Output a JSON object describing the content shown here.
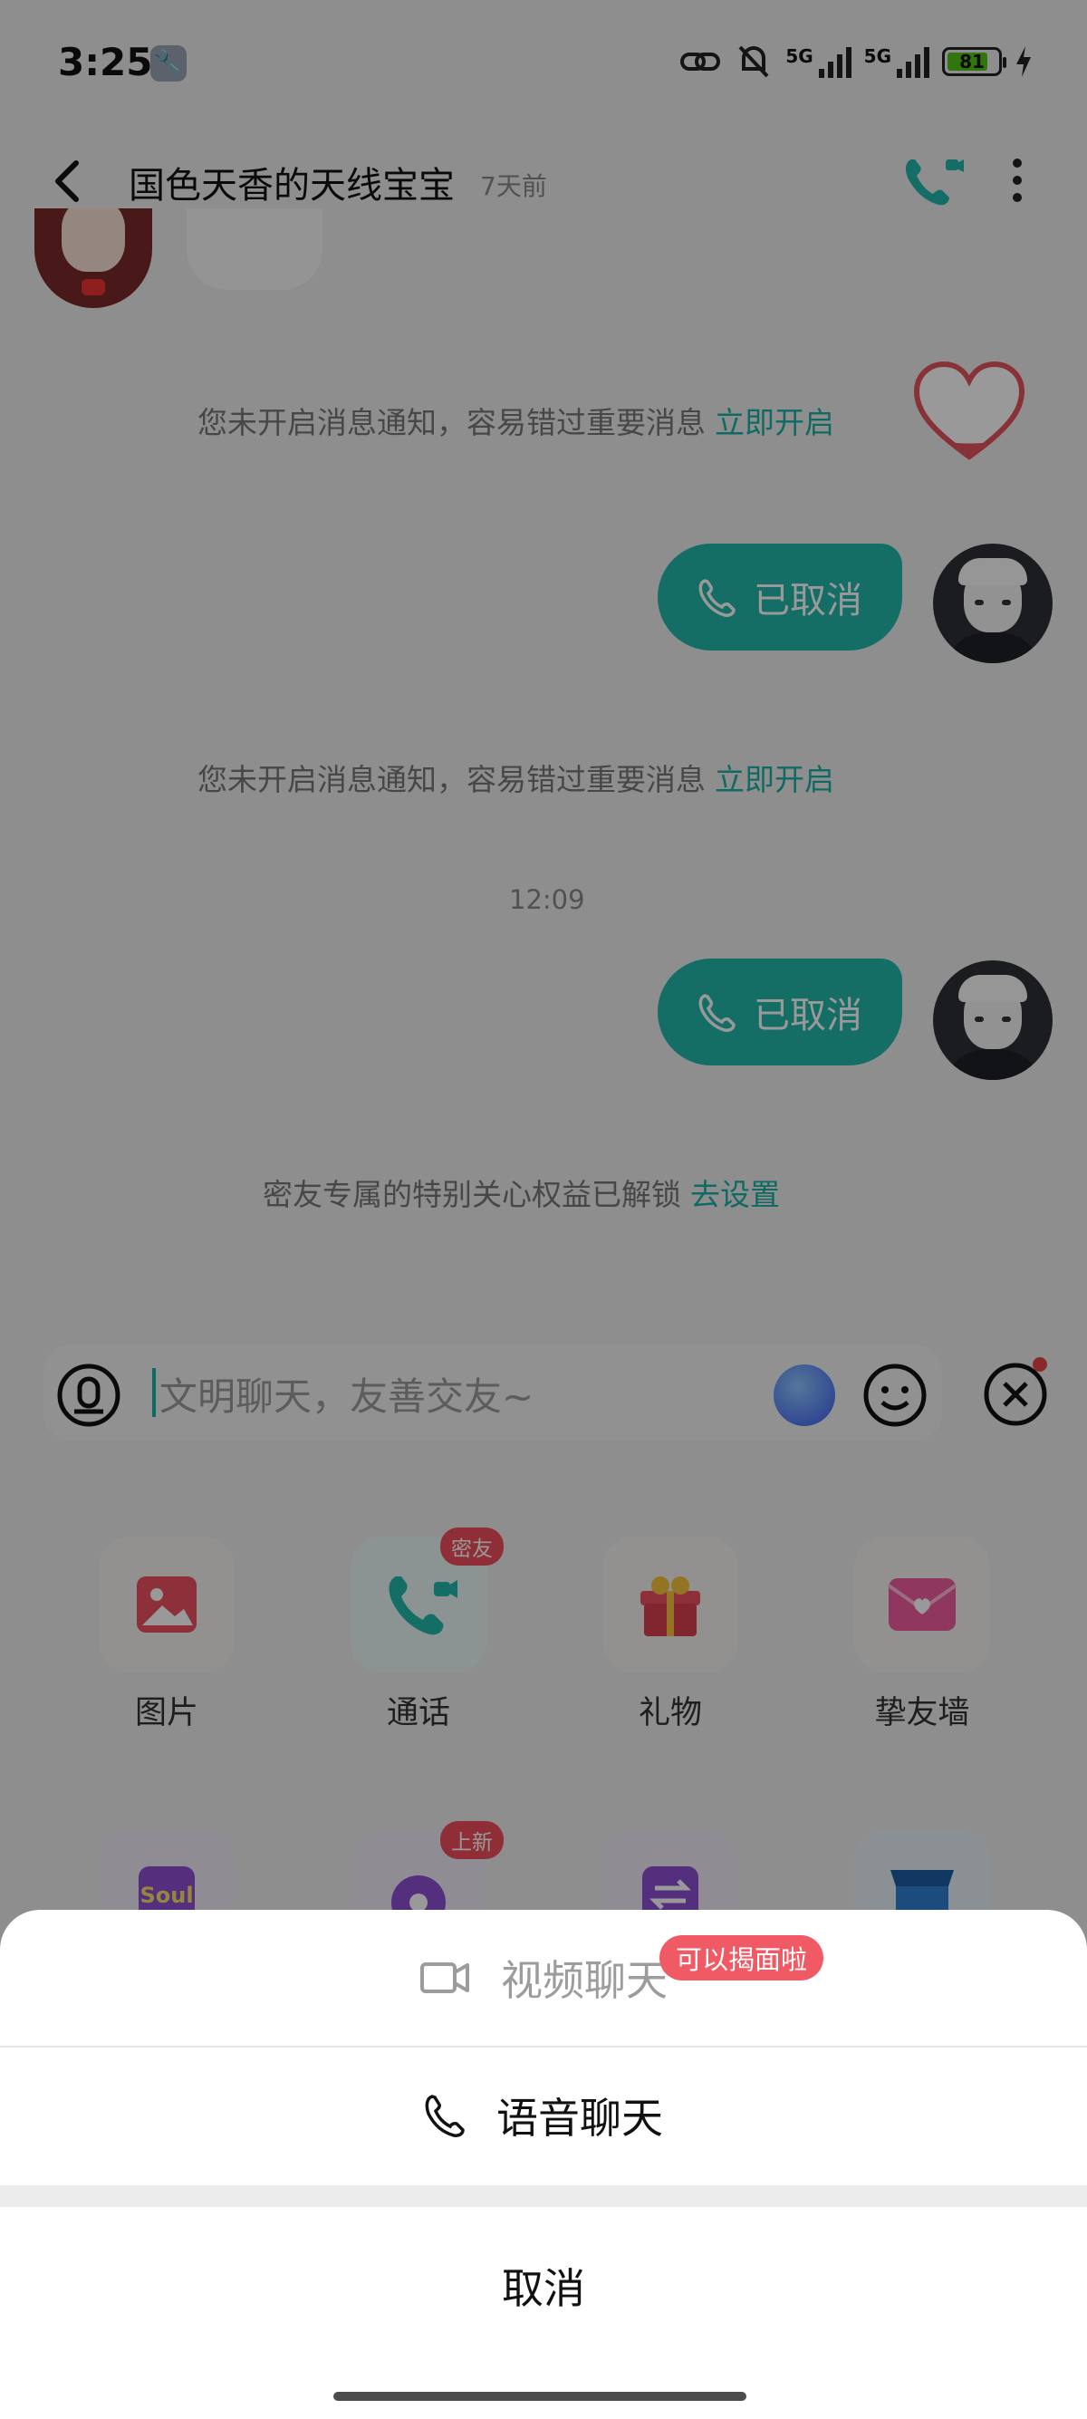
{
  "status_bar": {
    "time": "3:25",
    "network_1": "5G",
    "network_2": "5G",
    "battery": "81"
  },
  "header": {
    "title": "国色天香的天线宝宝",
    "subtitle": "7天前"
  },
  "chat": {
    "notice_1": {
      "text": "您未开启消息通知，容易错过重要消息",
      "link": "立即开启"
    },
    "call_1": "已取消",
    "notice_2": {
      "text": "您未开启消息通知，容易错过重要消息",
      "link": "立即开启"
    },
    "timestamp": "12:09",
    "call_2": "已取消",
    "notice_3": {
      "text": "密友专属的特别关心权益已解锁",
      "link": "去设置"
    }
  },
  "input": {
    "placeholder": "文明聊天，友善交友~"
  },
  "functions": [
    {
      "label": "图片",
      "icon": "image-icon"
    },
    {
      "label": "通话",
      "icon": "phone-video-icon",
      "badge": "密友"
    },
    {
      "label": "礼物",
      "icon": "gift-icon"
    },
    {
      "label": "挚友墙",
      "icon": "envelope-heart-icon"
    }
  ],
  "functions_row2": [
    {
      "icon": "soul-icon",
      "text": "Soul"
    },
    {
      "icon": "lens-icon",
      "badge": "上新"
    },
    {
      "icon": "swap-icon"
    },
    {
      "icon": "store-icon"
    }
  ],
  "sheet": {
    "video_label": "视频聊天",
    "video_badge": "可以揭面啦",
    "voice_label": "语音聊天",
    "cancel_label": "取消"
  },
  "colors": {
    "accent": "#23b7ab",
    "badge": "#ef4d5d",
    "link": "#1cb1a6"
  }
}
